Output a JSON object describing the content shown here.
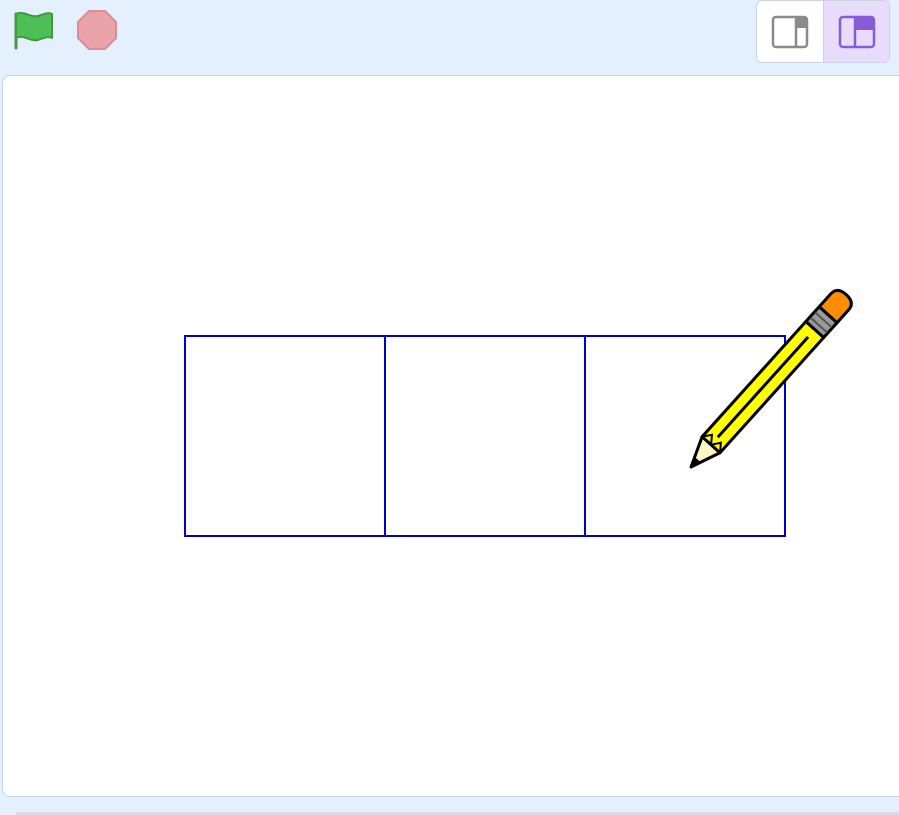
{
  "toolbar": {
    "green_flag": {
      "icon": "green-flag-icon",
      "color": "#4cbf56"
    },
    "stop": {
      "icon": "stop-icon",
      "color": "#ec9aa5"
    },
    "layout_toggle": {
      "small_stage": {
        "icon": "small-stage-mode-icon",
        "active": false
      },
      "normal_stage": {
        "icon": "normal-stage-mode-icon",
        "active": true
      },
      "accent": "#855cd6"
    }
  },
  "stage": {
    "drawing": {
      "shape": "row of three squares",
      "count": 3,
      "stroke_color": "#0000cc"
    },
    "sprite": {
      "name": "pencil",
      "icon": "pencil-sprite"
    }
  }
}
